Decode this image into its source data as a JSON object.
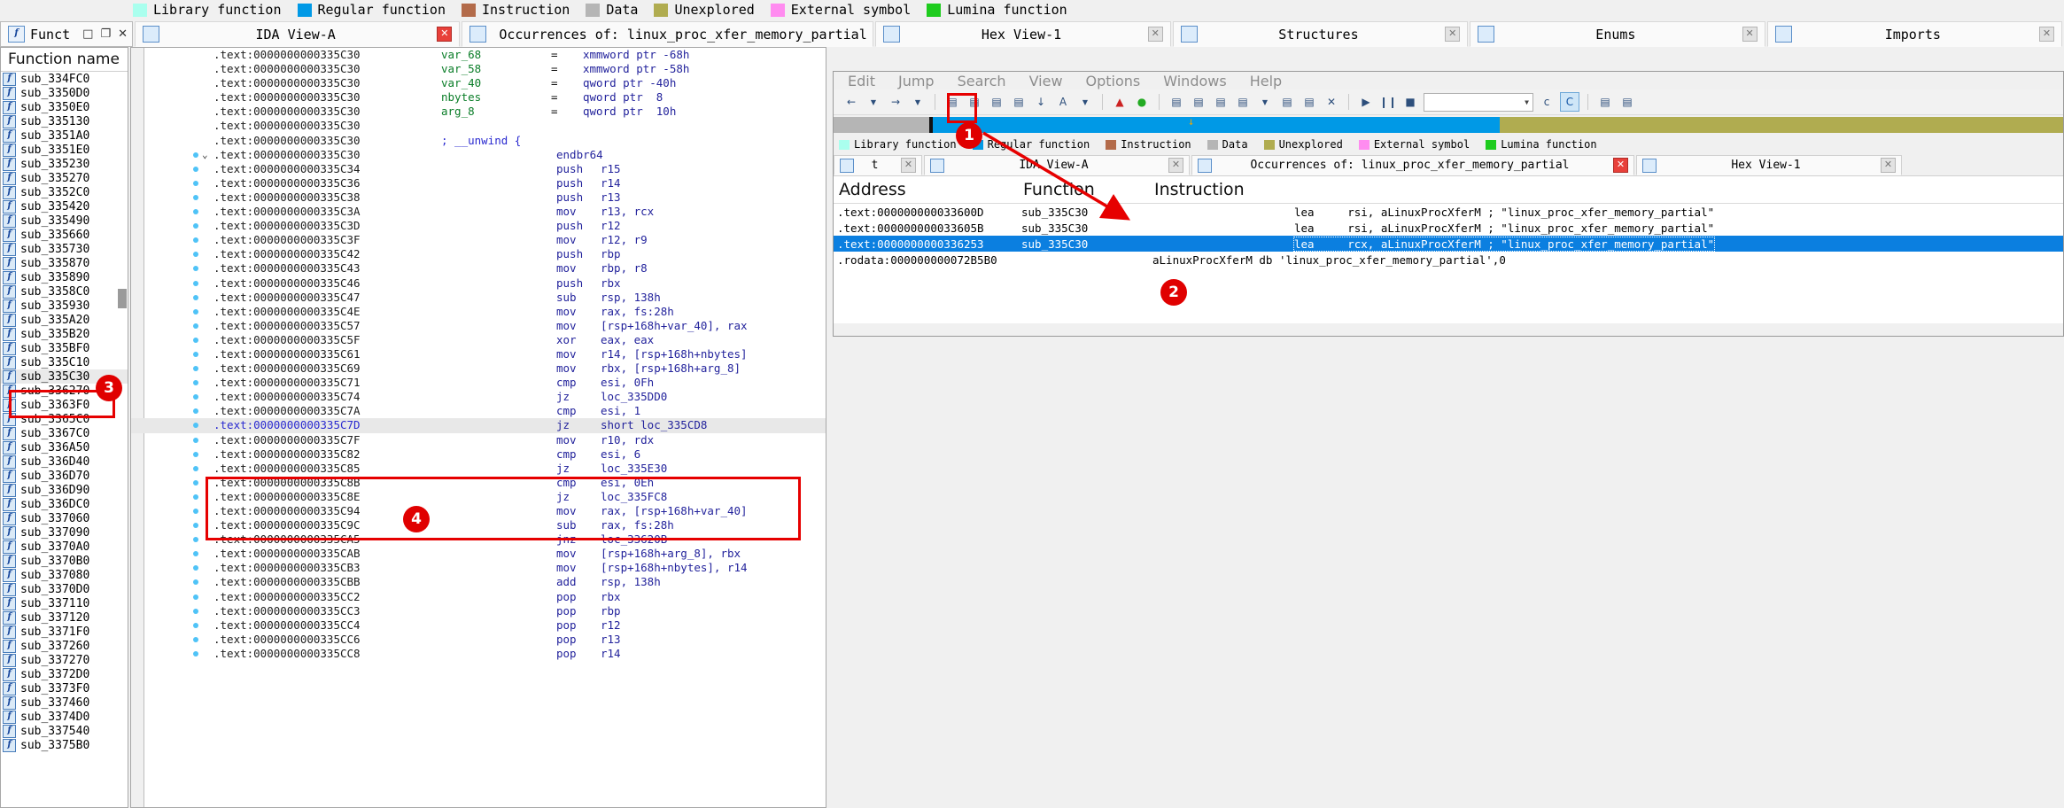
{
  "colors": {
    "library_function": "#aaffee",
    "regular_function": "#0099e6",
    "instruction": "#b36b4a",
    "data": "#b5b5b5",
    "unexplored": "#b0ac50",
    "external_symbol": "#ff8cf0",
    "lumina_function": "#1ecc1e",
    "selection_blue": "#0b7fe0",
    "annotation_red": "#e60000"
  },
  "legend": {
    "items": [
      {
        "label": "Library function",
        "color": "#aaffee"
      },
      {
        "label": "Regular function",
        "color": "#0099e6"
      },
      {
        "label": "Instruction",
        "color": "#b36b4a"
      },
      {
        "label": "Data",
        "color": "#b5b5b5"
      },
      {
        "label": "Unexplored",
        "color": "#b0ac50"
      },
      {
        "label": "External symbol",
        "color": "#ff8cf0"
      },
      {
        "label": "Lumina function",
        "color": "#1ecc1e"
      }
    ]
  },
  "main_tabs": [
    {
      "label": "Funct",
      "icon": "function-icon"
    },
    {
      "label": "IDA View-A",
      "icon": "document-icon"
    },
    {
      "label": "Occurrences of: linux_proc_xfer_memory_partial",
      "icon": "search-results-icon"
    },
    {
      "label": "Hex View-1",
      "icon": "hex-icon"
    },
    {
      "label": "Structures",
      "icon": "structures-icon"
    },
    {
      "label": "Enums",
      "icon": "enums-icon"
    },
    {
      "label": "Imports",
      "icon": "imports-icon"
    }
  ],
  "functions_panel": {
    "header": "Function name",
    "selected": "sub_335C30",
    "items": [
      "sub_334FC0",
      "sub_3350D0",
      "sub_3350E0",
      "sub_335130",
      "sub_3351A0",
      "sub_3351E0",
      "sub_335230",
      "sub_335270",
      "sub_3352C0",
      "sub_335420",
      "sub_335490",
      "sub_335660",
      "sub_335730",
      "sub_335870",
      "sub_335890",
      "sub_3358C0",
      "sub_335930",
      "sub_335A20",
      "sub_335B20",
      "sub_335BF0",
      "sub_335C10",
      "sub_335C30",
      "sub_336270",
      "sub_3363F0",
      "sub_3365C0",
      "sub_3367C0",
      "sub_336A50",
      "sub_336D40",
      "sub_336D70",
      "sub_336D90",
      "sub_336DC0",
      "sub_337060",
      "sub_337090",
      "sub_3370A0",
      "sub_3370B0",
      "sub_337080",
      "sub_3370D0",
      "sub_337110",
      "sub_337120",
      "sub_3371F0",
      "sub_337260",
      "sub_337270",
      "sub_3372D0",
      "sub_3373F0",
      "sub_337460",
      "sub_3374D0",
      "sub_337540",
      "sub_3375B0"
    ]
  },
  "disassembly": {
    "segment": ".text",
    "lines": [
      {
        "addr": ".text:0000000000335C30",
        "name": "var_68",
        "eq": "=",
        "mnemonic": "xmmword ptr -68h",
        "kind": "var"
      },
      {
        "addr": ".text:0000000000335C30",
        "name": "var_58",
        "eq": "=",
        "mnemonic": "xmmword ptr -58h",
        "kind": "var"
      },
      {
        "addr": ".text:0000000000335C30",
        "name": "var_40",
        "eq": "=",
        "mnemonic": "qword ptr -40h",
        "kind": "var"
      },
      {
        "addr": ".text:0000000000335C30",
        "name": "nbytes",
        "eq": "=",
        "mnemonic": "qword ptr  8",
        "kind": "var"
      },
      {
        "addr": ".text:0000000000335C30",
        "name": "arg_8",
        "eq": "=",
        "mnemonic": "qword ptr  10h",
        "kind": "var"
      },
      {
        "addr": ".text:0000000000335C30",
        "name": "",
        "eq": "",
        "mnemonic": "",
        "kind": "blank"
      },
      {
        "addr": ".text:0000000000335C30",
        "comment": "; __unwind {",
        "kind": "comment"
      },
      {
        "addr": ".text:0000000000335C30",
        "mnemonic": "endbr64",
        "operands": "",
        "kind": "code",
        "dot": true,
        "chevron": true
      },
      {
        "addr": ".text:0000000000335C34",
        "mnemonic": "push",
        "operands": "r15",
        "kind": "code",
        "dot": true
      },
      {
        "addr": ".text:0000000000335C36",
        "mnemonic": "push",
        "operands": "r14",
        "kind": "code",
        "dot": true
      },
      {
        "addr": ".text:0000000000335C38",
        "mnemonic": "push",
        "operands": "r13",
        "kind": "code",
        "dot": true
      },
      {
        "addr": ".text:0000000000335C3A",
        "mnemonic": "mov",
        "operands": "r13, rcx",
        "kind": "code",
        "dot": true
      },
      {
        "addr": ".text:0000000000335C3D",
        "mnemonic": "push",
        "operands": "r12",
        "kind": "code",
        "dot": true
      },
      {
        "addr": ".text:0000000000335C3F",
        "mnemonic": "mov",
        "operands": "r12, r9",
        "kind": "code",
        "dot": true
      },
      {
        "addr": ".text:0000000000335C42",
        "mnemonic": "push",
        "operands": "rbp",
        "kind": "code",
        "dot": true
      },
      {
        "addr": ".text:0000000000335C43",
        "mnemonic": "mov",
        "operands": "rbp, r8",
        "kind": "code",
        "dot": true
      },
      {
        "addr": ".text:0000000000335C46",
        "mnemonic": "push",
        "operands": "rbx",
        "kind": "code",
        "dot": true
      },
      {
        "addr": ".text:0000000000335C47",
        "mnemonic": "sub",
        "operands": "rsp, 138h",
        "kind": "code",
        "dot": true
      },
      {
        "addr": ".text:0000000000335C4E",
        "mnemonic": "mov",
        "operands": "rax, fs:28h",
        "kind": "code",
        "dot": true
      },
      {
        "addr": ".text:0000000000335C57",
        "mnemonic": "mov",
        "operands": "[rsp+168h+var_40], rax",
        "kind": "code",
        "dot": true
      },
      {
        "addr": ".text:0000000000335C5F",
        "mnemonic": "xor",
        "operands": "eax, eax",
        "kind": "code",
        "dot": true
      },
      {
        "addr": ".text:0000000000335C61",
        "mnemonic": "mov",
        "operands": "r14, [rsp+168h+nbytes]",
        "kind": "code",
        "dot": true
      },
      {
        "addr": ".text:0000000000335C69",
        "mnemonic": "mov",
        "operands": "rbx, [rsp+168h+arg_8]",
        "kind": "code",
        "dot": true
      },
      {
        "addr": ".text:0000000000335C71",
        "mnemonic": "cmp",
        "operands": "esi, 0Fh",
        "kind": "code",
        "dot": true
      },
      {
        "addr": ".text:0000000000335C74",
        "mnemonic": "jz",
        "operands": "loc_335DD0",
        "kind": "code",
        "dot": true
      },
      {
        "addr": ".text:0000000000335C7A",
        "mnemonic": "cmp",
        "operands": "esi, 1",
        "kind": "code",
        "dot": true
      },
      {
        "addr": ".text:0000000000335C7D",
        "mnemonic": "jz",
        "operands": "short loc_335CD8",
        "kind": "code",
        "dot": true,
        "selected": true
      },
      {
        "addr": ".text:0000000000335C7F",
        "mnemonic": "mov",
        "operands": "r10, rdx",
        "kind": "code",
        "dot": true
      },
      {
        "addr": ".text:0000000000335C82",
        "mnemonic": "cmp",
        "operands": "esi, 6",
        "kind": "code",
        "dot": true
      },
      {
        "addr": ".text:0000000000335C85",
        "mnemonic": "jz",
        "operands": "loc_335E30",
        "kind": "code",
        "dot": true
      },
      {
        "addr": ".text:0000000000335C8B",
        "mnemonic": "cmp",
        "operands": "esi, 0Eh",
        "kind": "code",
        "dot": true
      },
      {
        "addr": ".text:0000000000335C8E",
        "mnemonic": "jz",
        "operands": "loc_335FC8",
        "kind": "code",
        "dot": true
      },
      {
        "addr": ".text:0000000000335C94",
        "mnemonic": "mov",
        "operands": "rax, [rsp+168h+var_40]",
        "kind": "code",
        "dot": true
      },
      {
        "addr": ".text:0000000000335C9C",
        "mnemonic": "sub",
        "operands": "rax, fs:28h",
        "kind": "code",
        "dot": true
      },
      {
        "addr": ".text:0000000000335CA5",
        "mnemonic": "jnz",
        "operands": "loc_33620B",
        "kind": "code",
        "dot": true
      },
      {
        "addr": ".text:0000000000335CAB",
        "mnemonic": "mov",
        "operands": "[rsp+168h+arg_8], rbx",
        "kind": "code",
        "dot": true
      },
      {
        "addr": ".text:0000000000335CB3",
        "mnemonic": "mov",
        "operands": "[rsp+168h+nbytes], r14",
        "kind": "code",
        "dot": true
      },
      {
        "addr": ".text:0000000000335CBB",
        "mnemonic": "add",
        "operands": "rsp, 138h",
        "kind": "code",
        "dot": true
      },
      {
        "addr": ".text:0000000000335CC2",
        "mnemonic": "pop",
        "operands": "rbx",
        "kind": "code",
        "dot": true
      },
      {
        "addr": ".text:0000000000335CC3",
        "mnemonic": "pop",
        "operands": "rbp",
        "kind": "code",
        "dot": true
      },
      {
        "addr": ".text:0000000000335CC4",
        "mnemonic": "pop",
        "operands": "r12",
        "kind": "code",
        "dot": true
      },
      {
        "addr": ".text:0000000000335CC6",
        "mnemonic": "pop",
        "operands": "r13",
        "kind": "code",
        "dot": true
      },
      {
        "addr": ".text:0000000000335CC8",
        "mnemonic": "pop",
        "operands": "r14",
        "kind": "code",
        "dot": true
      }
    ]
  },
  "floating_window": {
    "menu": [
      "Edit",
      "Jump",
      "Search",
      "View",
      "Options",
      "Windows",
      "Help"
    ],
    "toolbar_combo_value": "",
    "tabs": [
      {
        "label": "t",
        "icon": "function-icon"
      },
      {
        "label": "IDA View-A",
        "icon": "document-icon"
      },
      {
        "label": "Occurrences of: linux_proc_xfer_memory_partial",
        "icon": "search-results-icon"
      },
      {
        "label": "Hex View-1",
        "icon": "hex-icon"
      }
    ],
    "occurrences": {
      "columns": [
        "Address",
        "Function",
        "Instruction"
      ],
      "rows": [
        {
          "address": ".text:000000000033600D",
          "function": "sub_335C30",
          "instruction": "lea     rsi, aLinuxProcXferM ; \"linux_proc_xfer_memory_partial\"",
          "selected": false
        },
        {
          "address": ".text:000000000033605B",
          "function": "sub_335C30",
          "instruction": "lea     rsi, aLinuxProcXferM ; \"linux_proc_xfer_memory_partial\"",
          "selected": false
        },
        {
          "address": ".text:0000000000336253",
          "function": "sub_335C30",
          "instruction": "lea     rcx, aLinuxProcXferM ; \"linux_proc_xfer_memory_partial\"",
          "selected": true
        },
        {
          "address": ".rodata:000000000072B5B0",
          "function": "",
          "instruction": "aLinuxProcXferM db 'linux_proc_xfer_memory_partial',0",
          "selected": false,
          "instruction_left": true
        }
      ]
    }
  },
  "annotations": {
    "badges": [
      {
        "number": "1",
        "target": "text-search-toolbar-button"
      },
      {
        "number": "2",
        "target": "occurrences-selected-row"
      },
      {
        "number": "3",
        "target": "function-list-selected-item"
      },
      {
        "number": "4",
        "target": "disassembly-selected-line"
      }
    ]
  }
}
